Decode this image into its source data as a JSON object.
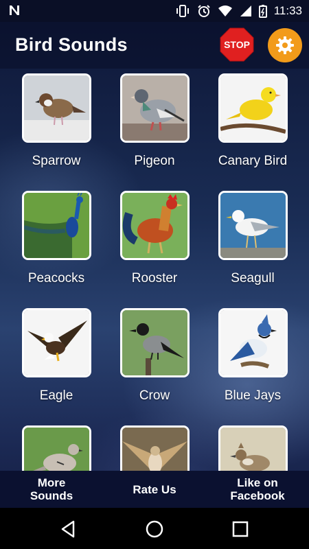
{
  "status_bar": {
    "notification_icon": "n-icon",
    "time": "11:33",
    "icons": [
      "vibrate-icon",
      "alarm-icon",
      "wifi-icon",
      "signal-icon",
      "battery-icon"
    ]
  },
  "header": {
    "title": "Bird Sounds",
    "stop_label": "STOP",
    "stop_color": "#e02020",
    "settings_icon": "gear-icon",
    "settings_color": "#f29b1a"
  },
  "birds": [
    {
      "name": "Sparrow",
      "icon": "sparrow-photo"
    },
    {
      "name": "Pigeon",
      "icon": "pigeon-photo"
    },
    {
      "name": "Canary Bird",
      "icon": "canary-photo"
    },
    {
      "name": "Peacocks",
      "icon": "peacock-photo"
    },
    {
      "name": "Rooster",
      "icon": "rooster-photo"
    },
    {
      "name": "Seagull",
      "icon": "seagull-photo"
    },
    {
      "name": "Eagle",
      "icon": "eagle-photo"
    },
    {
      "name": "Crow",
      "icon": "crow-photo"
    },
    {
      "name": "Blue Jays",
      "icon": "blue-jay-photo"
    },
    {
      "name": "",
      "icon": "dove-photo"
    },
    {
      "name": "",
      "icon": "hawk-photo"
    },
    {
      "name": "",
      "icon": "lark-photo"
    }
  ],
  "bottom_bar": {
    "more_sounds": "More\nSounds",
    "rate_us": "Rate Us",
    "like_facebook": "Like on\nFacebook"
  },
  "nav_bar": {
    "back_icon": "back-icon",
    "home_icon": "home-icon",
    "recents_icon": "recents-icon"
  }
}
